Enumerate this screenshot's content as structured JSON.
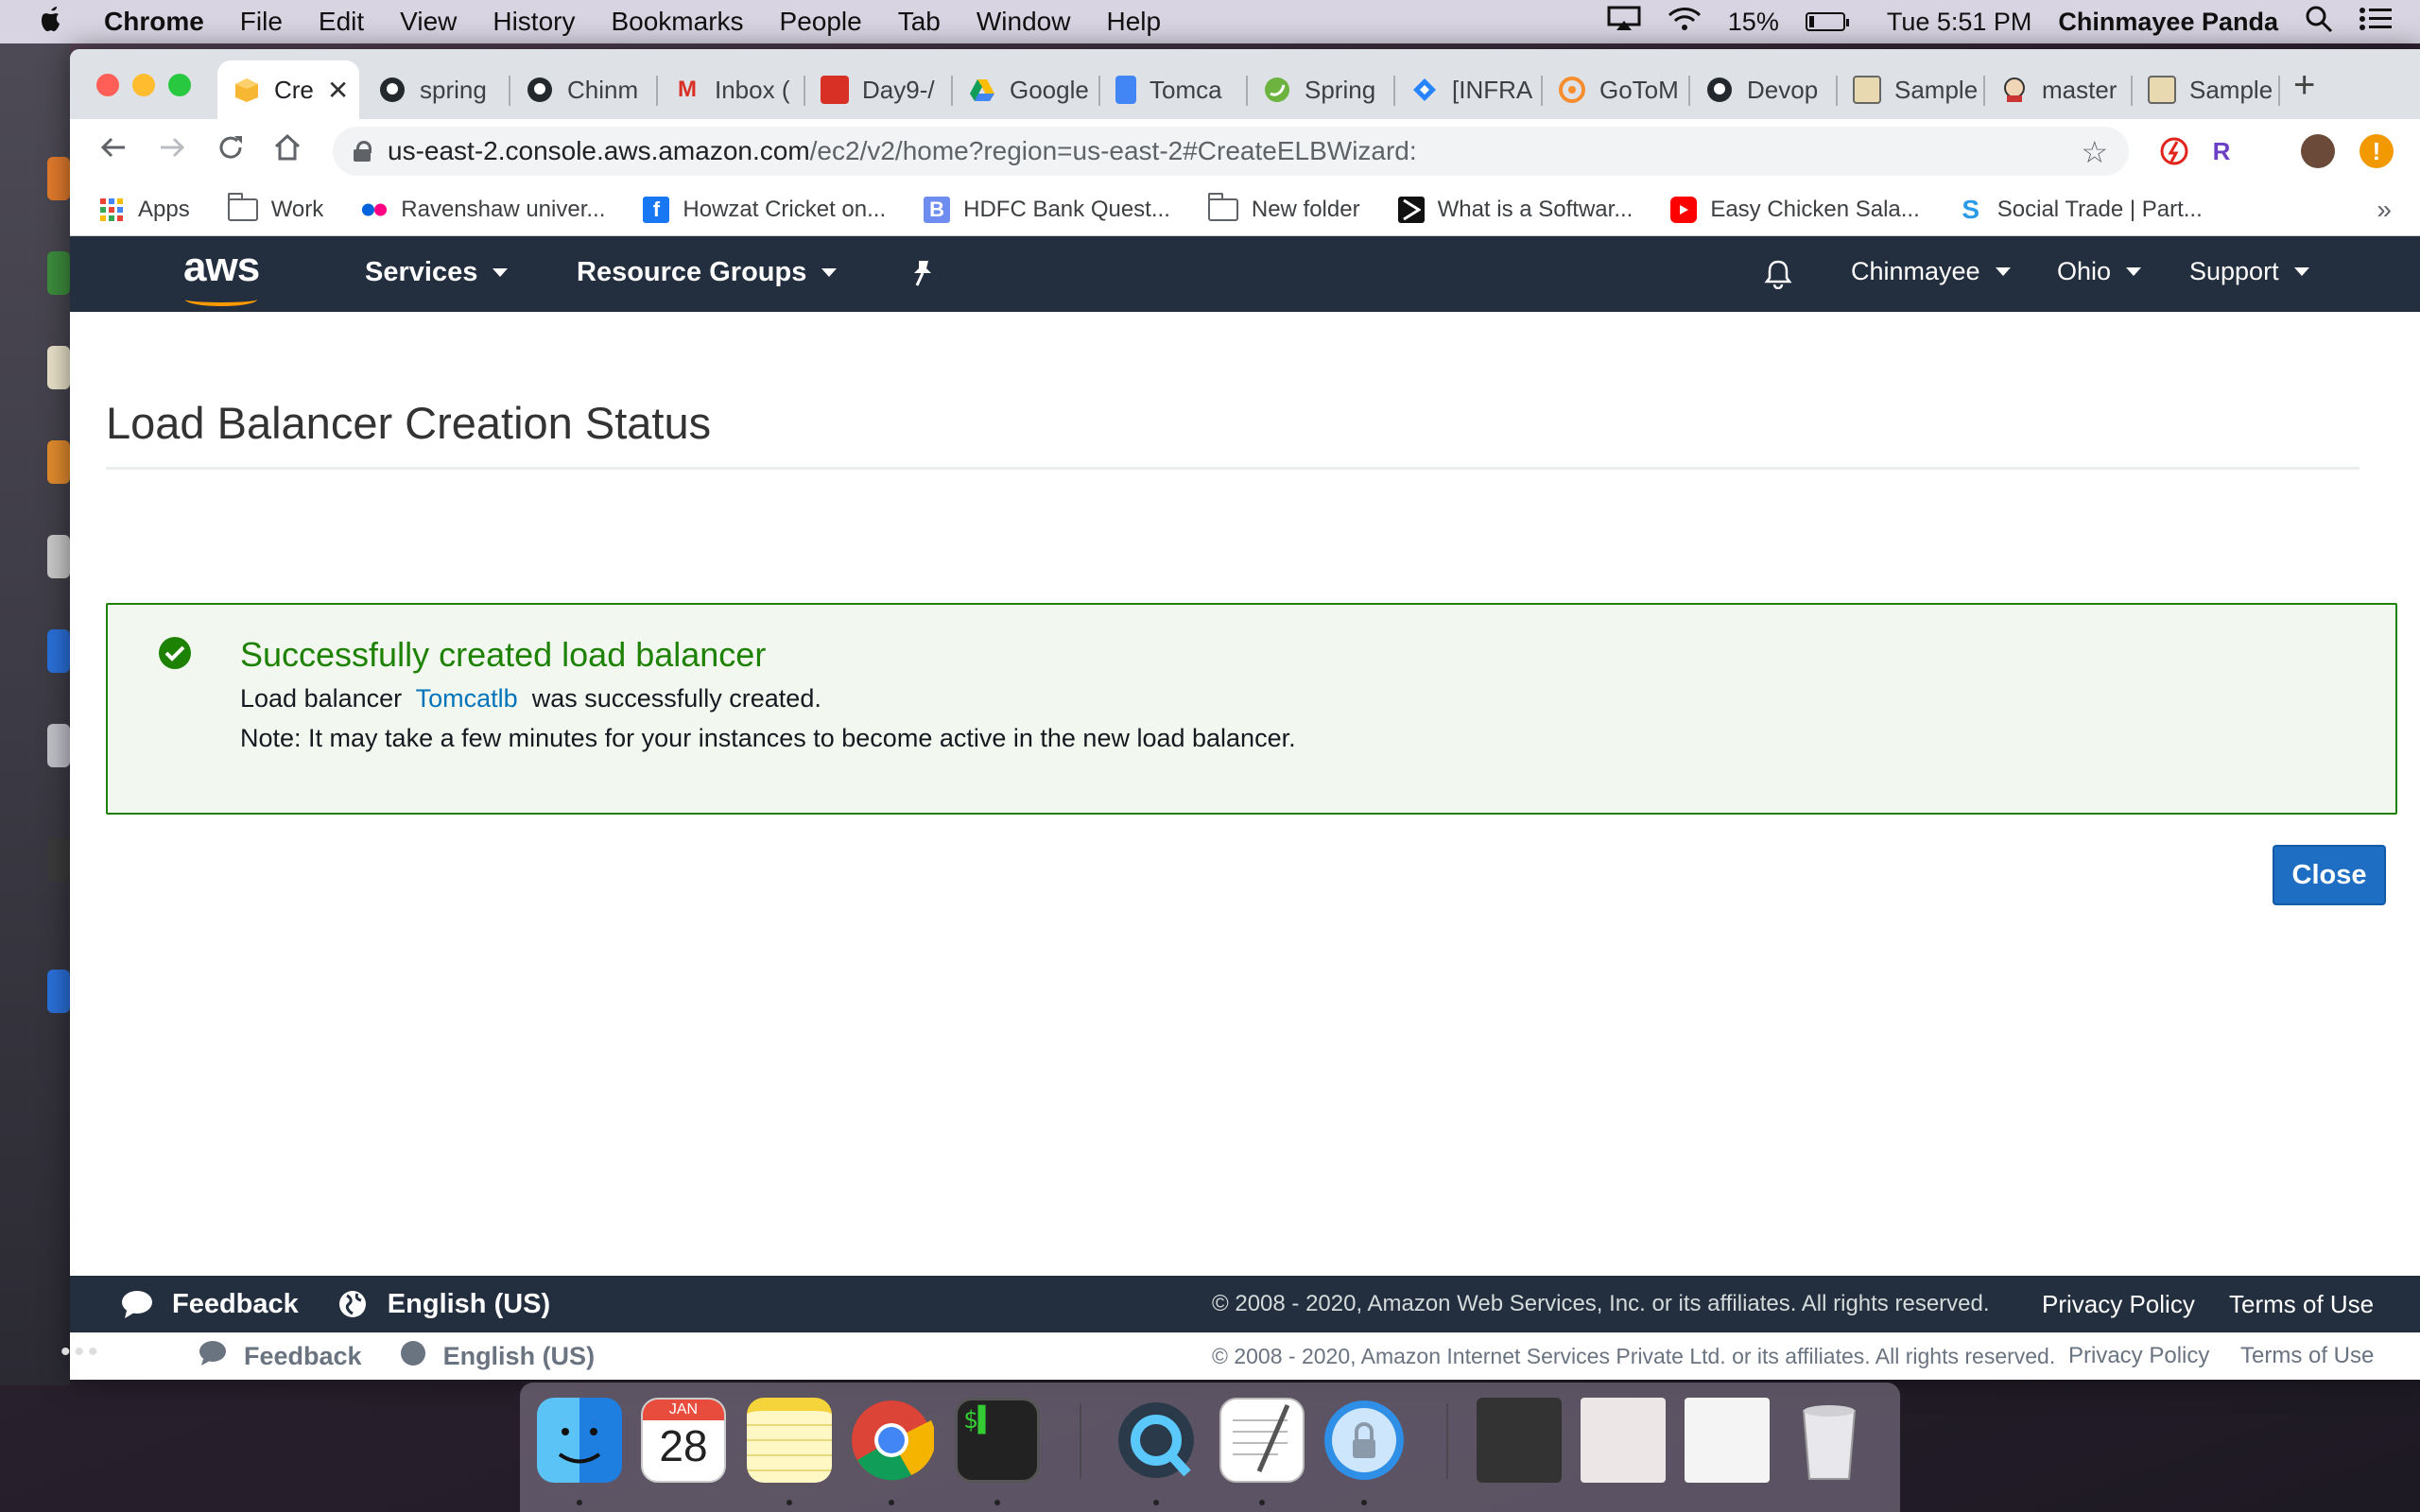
{
  "menubar": {
    "apple": "",
    "app": "Chrome",
    "items": [
      "File",
      "Edit",
      "View",
      "History",
      "Bookmarks",
      "People",
      "Tab",
      "Window",
      "Help"
    ],
    "battery": "15%",
    "battery_level": 0.15,
    "clock": "Tue 5:51 PM",
    "user": "Chinmayee Panda"
  },
  "tabs": [
    {
      "label": "Cre",
      "icon": "aws-box-icon"
    },
    {
      "label": "spring",
      "icon": "github-icon"
    },
    {
      "label": "Chinm",
      "icon": "github-icon"
    },
    {
      "label": "Inbox (",
      "icon": "gmail-icon"
    },
    {
      "label": "Day9-/",
      "icon": "video-icon"
    },
    {
      "label": "Google",
      "icon": "drive-icon"
    },
    {
      "label": "Tomca",
      "icon": "docs-icon"
    },
    {
      "label": "Spring",
      "icon": "spring-icon"
    },
    {
      "label": "[INFRA",
      "icon": "jira-icon"
    },
    {
      "label": "GoToM",
      "icon": "gotomeeting-icon"
    },
    {
      "label": "Devop",
      "icon": "github-icon"
    },
    {
      "label": "Sample",
      "icon": "image-icon"
    },
    {
      "label": "master",
      "icon": "jenkins-icon"
    },
    {
      "label": "Sample",
      "icon": "image-icon"
    }
  ],
  "toolbar": {
    "url_host": "us-east-2.console.aws.amazon.com",
    "url_path": "/ec2/v2/home?region=us-east-2#CreateELBWizard:"
  },
  "bookmarks": [
    {
      "label": "Apps",
      "icon": "apps-grid-icon"
    },
    {
      "label": "Work",
      "icon": "folder-icon"
    },
    {
      "label": "Ravenshaw univer...",
      "icon": "flickr-icon"
    },
    {
      "label": "Howzat Cricket on...",
      "icon": "facebook-icon"
    },
    {
      "label": "HDFC Bank Quest...",
      "icon": "b-icon"
    },
    {
      "label": "New folder",
      "icon": "folder-icon"
    },
    {
      "label": "What is a Softwar...",
      "icon": "site-icon"
    },
    {
      "label": "Easy Chicken Sala...",
      "icon": "youtube-icon"
    },
    {
      "label": "Social Trade | Part...",
      "icon": "s-icon"
    }
  ],
  "aws_nav": {
    "logo": "aws",
    "services": "Services",
    "resource_groups": "Resource Groups",
    "account": "Chinmayee",
    "region": "Ohio",
    "support": "Support"
  },
  "page": {
    "title": "Load Balancer Creation Status",
    "alert": {
      "heading": "Successfully created load balancer",
      "line1_prefix": "Load balancer",
      "lb_name": "Tomcatlb",
      "line1_suffix": "was successfully created.",
      "line2": "Note: It may take a few minutes for your instances to become active in the new load balancer."
    },
    "close_button": "Close"
  },
  "footer": {
    "feedback": "Feedback",
    "language": "English (US)",
    "copyright": "© 2008 - 2020, Amazon Web Services, Inc. or its affiliates. All rights reserved.",
    "privacy": "Privacy Policy",
    "terms": "Terms of Use"
  },
  "ghost_footer": {
    "feedback": "Feedback",
    "language": "English (US)",
    "copyright": "© 2008 - 2020, Amazon Internet Services Private Ltd. or its affiliates. All rights reserved.",
    "privacy": "Privacy Policy",
    "terms": "Terms of Use"
  },
  "dock": {
    "calendar_month": "JAN",
    "calendar_day": "28",
    "apps": [
      "finder",
      "calendar",
      "notes",
      "chrome",
      "terminal",
      "quicktime",
      "textedit",
      "keychain",
      "folder",
      "document-1",
      "document-2",
      "trash"
    ]
  },
  "colors": {
    "aws_nav": "#232f3e",
    "aws_orange": "#ff9900",
    "success_green": "#1d8102",
    "link_blue": "#0073bb",
    "button_blue": "#1e6fc4"
  }
}
